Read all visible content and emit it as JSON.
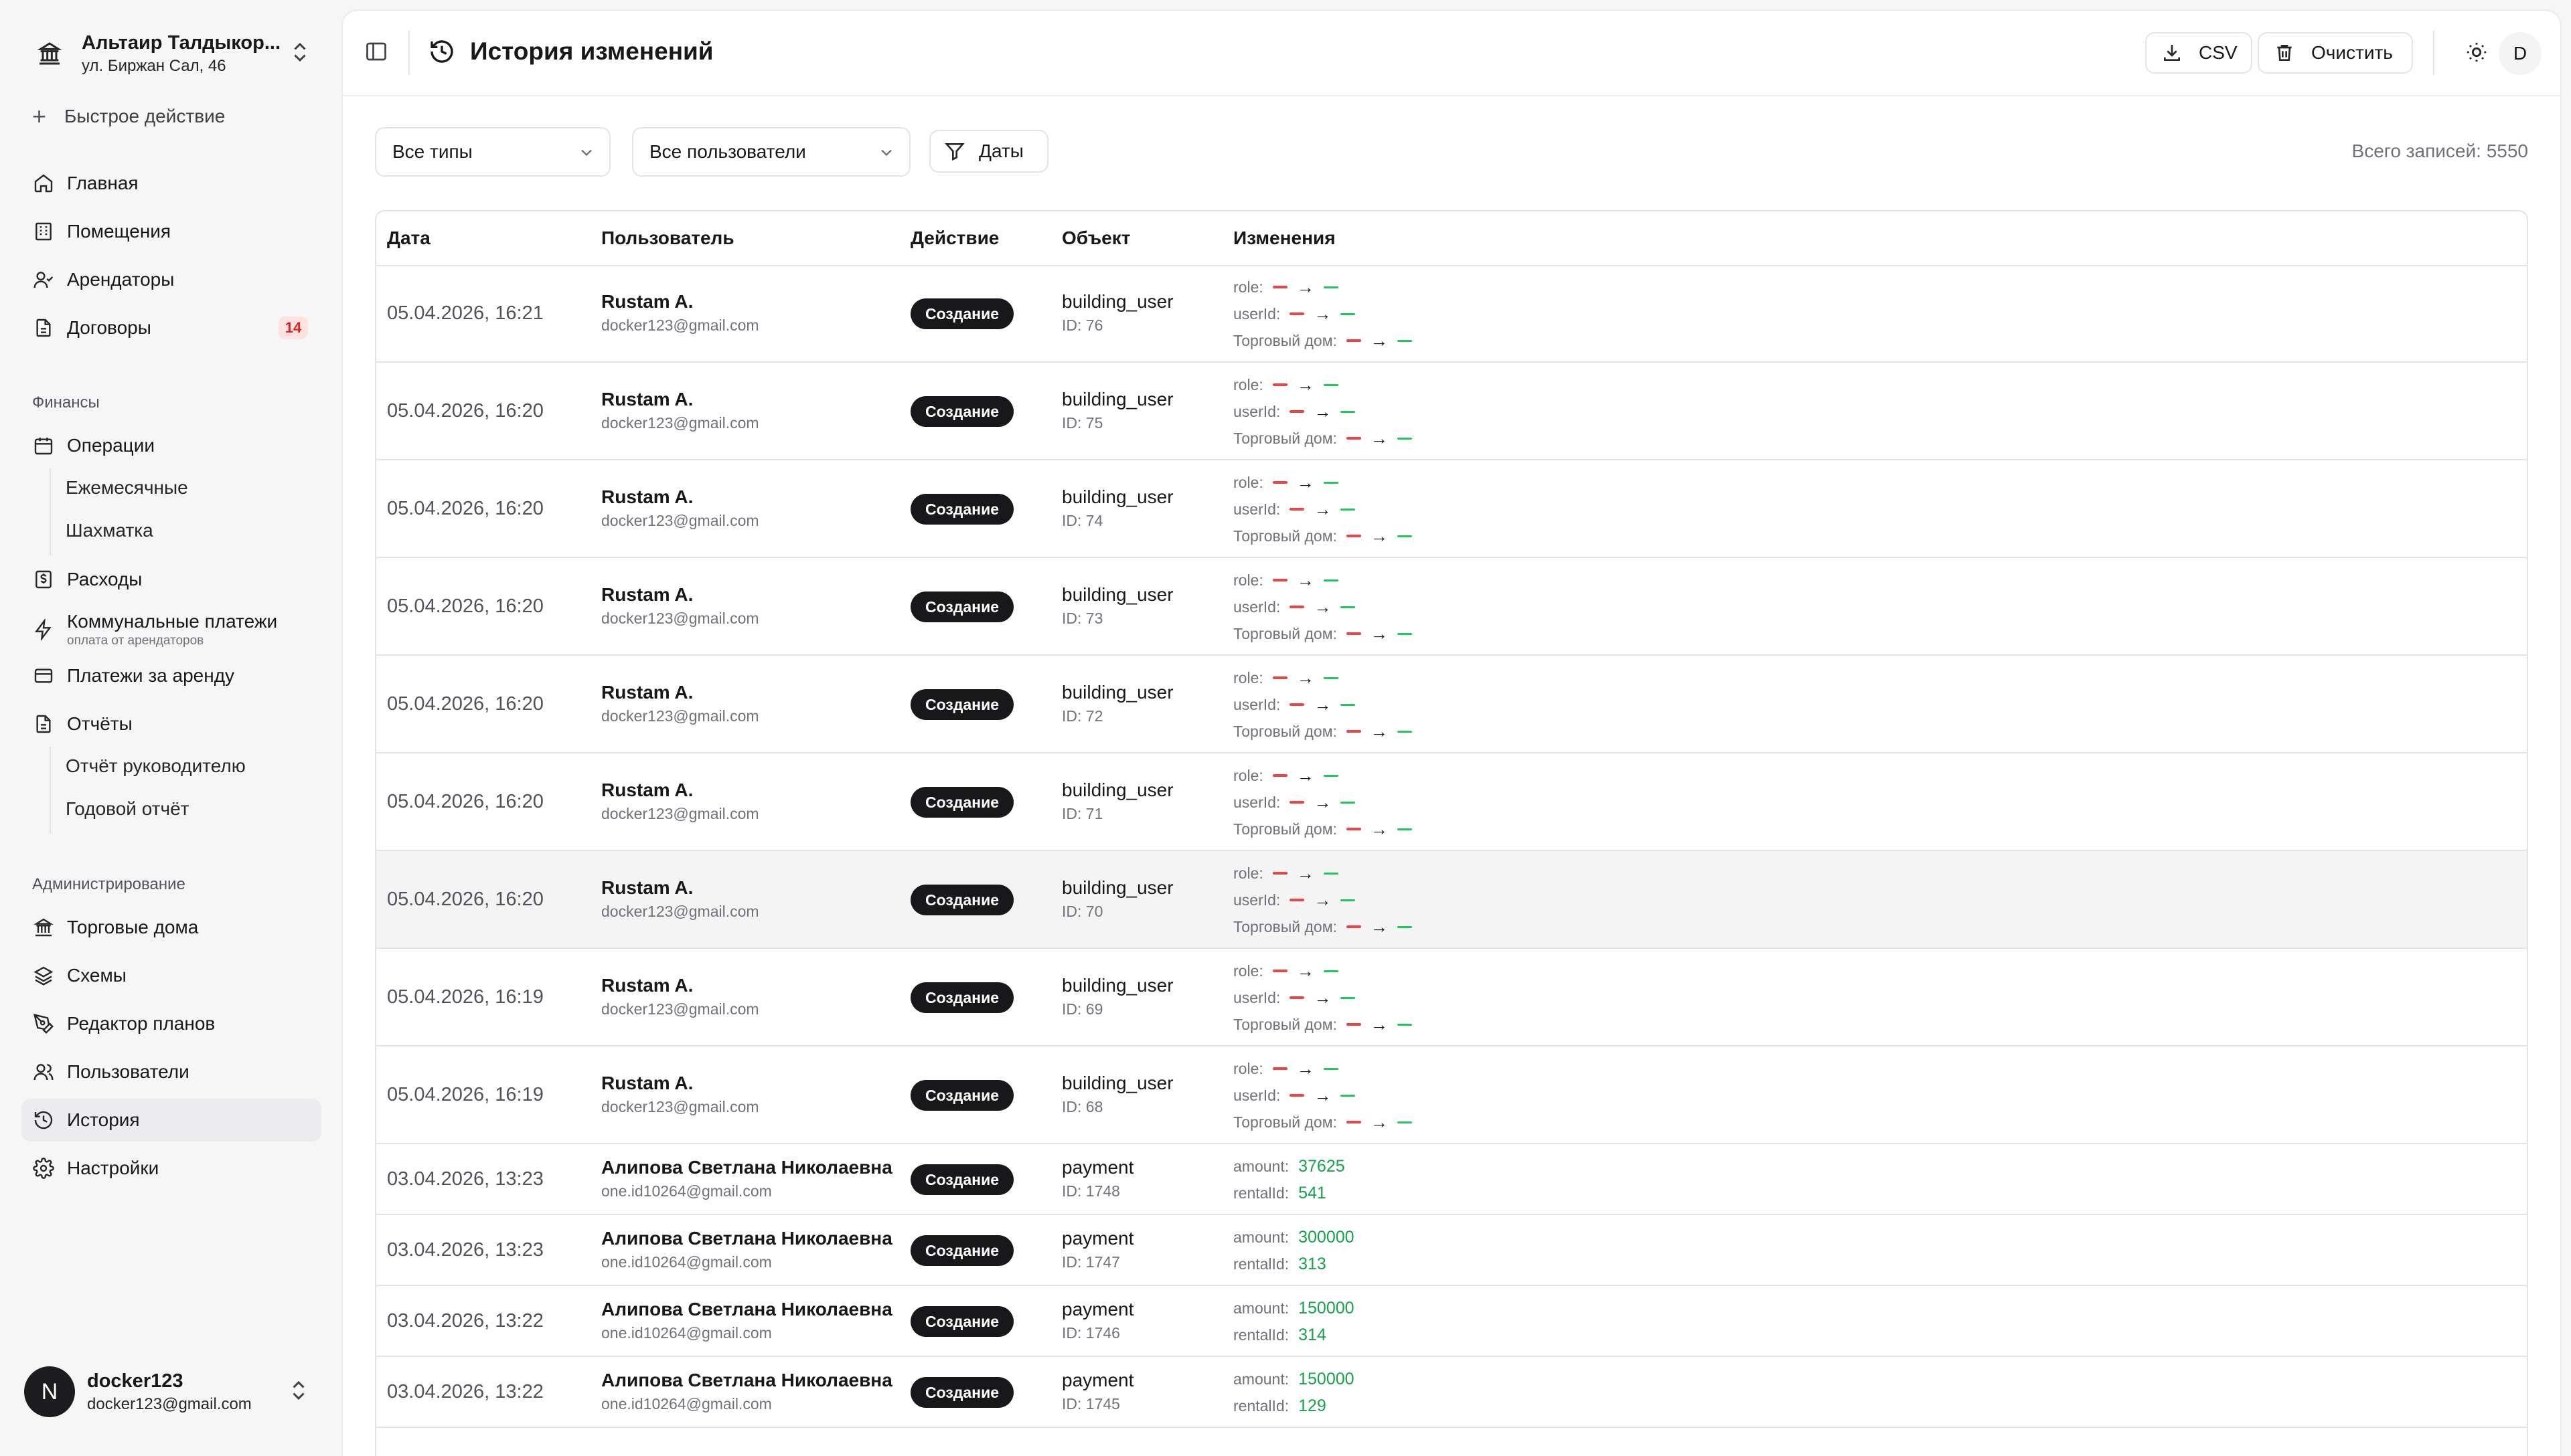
{
  "org": {
    "name": "Альтаир Талдыкор...",
    "address": "ул. Биржан Сал, 46"
  },
  "quick_action": "Быстрое действие",
  "nav": {
    "home": "Главная",
    "rooms": "Помещения",
    "tenants": "Арендаторы",
    "contracts": "Договоры",
    "contracts_badge": "14",
    "finance_title": "Финансы",
    "operations": "Операции",
    "monthly": "Ежемесячные",
    "chess": "Шахматка",
    "expenses": "Расходы",
    "utilities": "Коммунальные платежи",
    "utilities_sub": "оплата от арендаторов",
    "rent_payments": "Платежи за аренду",
    "reports": "Отчёты",
    "manager_report": "Отчёт руководителю",
    "annual_report": "Годовой отчёт",
    "admin_title": "Администрирование",
    "trade_houses": "Торговые дома",
    "schemes": "Схемы",
    "plan_editor": "Редактор планов",
    "users": "Пользователи",
    "history": "История",
    "settings": "Настройки"
  },
  "user": {
    "initial": "N",
    "name": "docker123",
    "email": "docker123@gmail.com"
  },
  "header": {
    "title": "История изменений",
    "csv": "CSV",
    "clear": "Очистить",
    "avatar": "D"
  },
  "filters": {
    "types": "Все типы",
    "users": "Все пользователи",
    "dates": "Даты",
    "total": "Всего записей: 5550"
  },
  "table": {
    "columns": [
      "Дата",
      "Пользователь",
      "Действие",
      "Объект",
      "Изменения"
    ],
    "rows_bu": [
      {
        "date": "05.04.2026, 16:21",
        "user": "Rustam A.",
        "email": "docker123@gmail.com",
        "action": "Создание",
        "object": "building_user",
        "id": "ID: 76"
      },
      {
        "date": "05.04.2026, 16:20",
        "user": "Rustam A.",
        "email": "docker123@gmail.com",
        "action": "Создание",
        "object": "building_user",
        "id": "ID: 75"
      },
      {
        "date": "05.04.2026, 16:20",
        "user": "Rustam A.",
        "email": "docker123@gmail.com",
        "action": "Создание",
        "object": "building_user",
        "id": "ID: 74"
      },
      {
        "date": "05.04.2026, 16:20",
        "user": "Rustam A.",
        "email": "docker123@gmail.com",
        "action": "Создание",
        "object": "building_user",
        "id": "ID: 73"
      },
      {
        "date": "05.04.2026, 16:20",
        "user": "Rustam A.",
        "email": "docker123@gmail.com",
        "action": "Создание",
        "object": "building_user",
        "id": "ID: 72"
      },
      {
        "date": "05.04.2026, 16:20",
        "user": "Rustam A.",
        "email": "docker123@gmail.com",
        "action": "Создание",
        "object": "building_user",
        "id": "ID: 71"
      },
      {
        "date": "05.04.2026, 16:20",
        "user": "Rustam A.",
        "email": "docker123@gmail.com",
        "action": "Создание",
        "object": "building_user",
        "id": "ID: 70"
      },
      {
        "date": "05.04.2026, 16:19",
        "user": "Rustam A.",
        "email": "docker123@gmail.com",
        "action": "Создание",
        "object": "building_user",
        "id": "ID: 69"
      },
      {
        "date": "05.04.2026, 16:19",
        "user": "Rustam A.",
        "email": "docker123@gmail.com",
        "action": "Создание",
        "object": "building_user",
        "id": "ID: 68"
      }
    ],
    "bu_keys": [
      "role:",
      "userId:",
      "Торговый дом:"
    ],
    "rows_pay": [
      {
        "date": "03.04.2026, 13:23",
        "user": "Алипова Светлана Николаевна",
        "email": "one.id10264@gmail.com",
        "action": "Создание",
        "object": "payment",
        "id": "ID: 1748",
        "amount_key": "amount:",
        "amount": "37625",
        "rental_key": "rentalId:",
        "rental": "541"
      },
      {
        "date": "03.04.2026, 13:23",
        "user": "Алипова Светлана Николаевна",
        "email": "one.id10264@gmail.com",
        "action": "Создание",
        "object": "payment",
        "id": "ID: 1747",
        "amount_key": "amount:",
        "amount": "300000",
        "rental_key": "rentalId:",
        "rental": "313"
      },
      {
        "date": "03.04.2026, 13:22",
        "user": "Алипова Светлана Николаевна",
        "email": "one.id10264@gmail.com",
        "action": "Создание",
        "object": "payment",
        "id": "ID: 1746",
        "amount_key": "amount:",
        "amount": "150000",
        "rental_key": "rentalId:",
        "rental": "314"
      },
      {
        "date": "03.04.2026, 13:22",
        "user": "Алипова Светлана Николаевна",
        "email": "one.id10264@gmail.com",
        "action": "Создание",
        "object": "payment",
        "id": "ID: 1745",
        "amount_key": "amount:",
        "amount": "150000",
        "rental_key": "rentalId:",
        "rental": "129"
      }
    ]
  }
}
